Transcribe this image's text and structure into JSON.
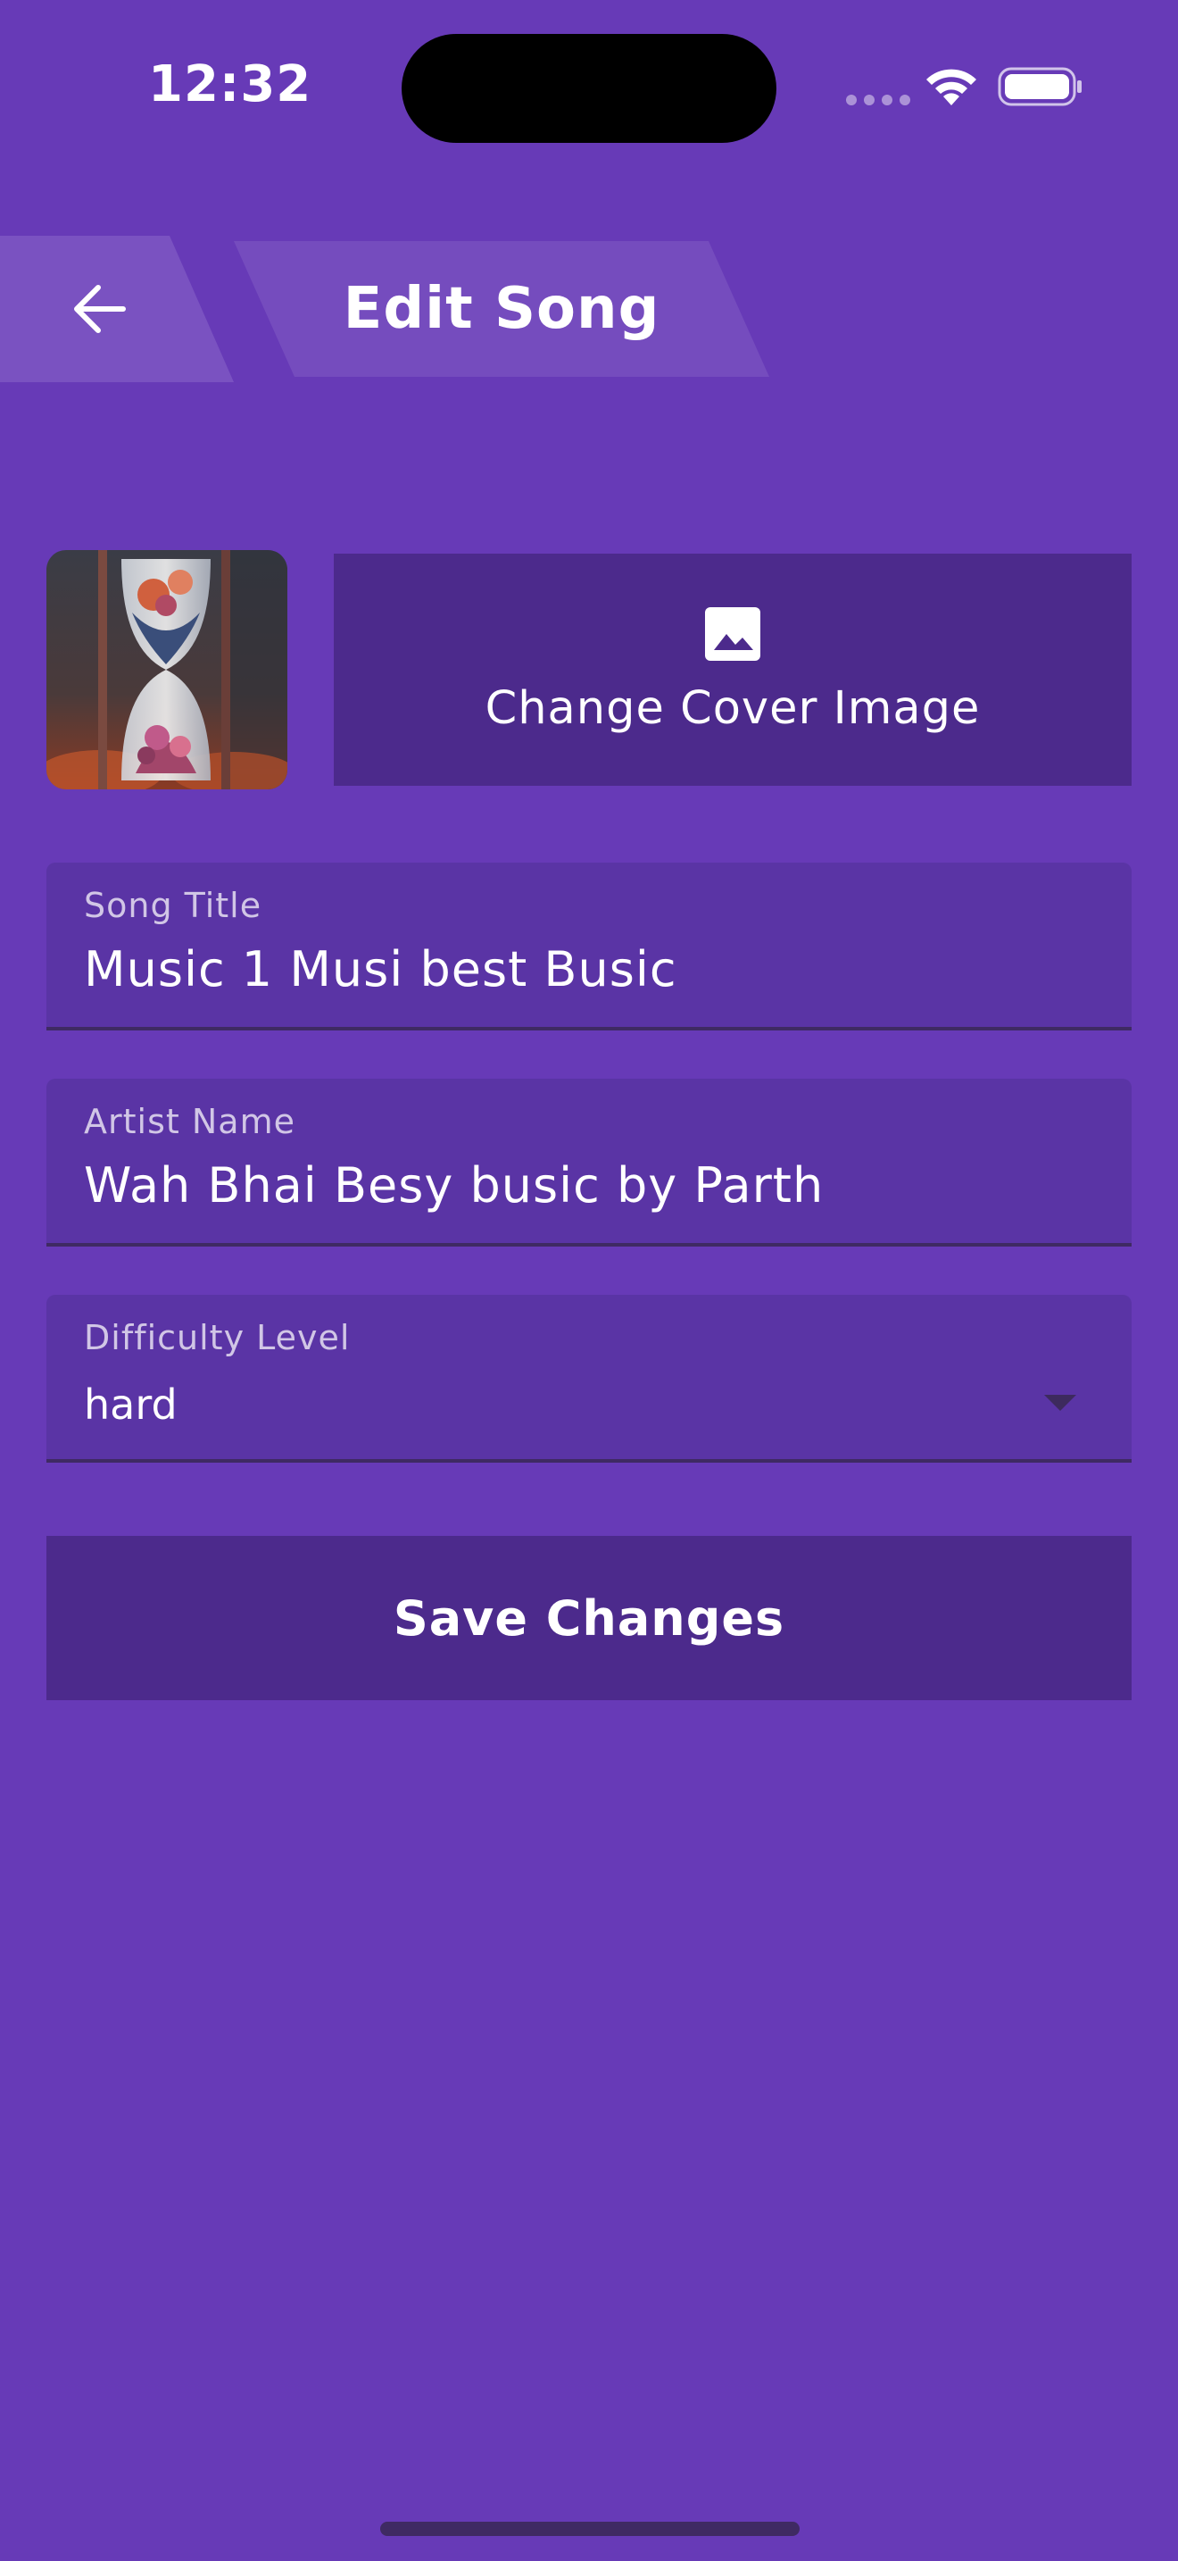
{
  "status_bar": {
    "time": "12:32",
    "icons": [
      "signal-icon",
      "wifi-icon",
      "battery-icon"
    ]
  },
  "header": {
    "back_icon": "arrow-left-icon",
    "title": "Edit Song"
  },
  "cover": {
    "thumbnail": "hourglass-cover-image",
    "change_label": "Change Cover Image",
    "change_icon": "image-icon"
  },
  "form": {
    "song_title": {
      "label": "Song Title",
      "value": "Music 1 Musi best Busic"
    },
    "artist_name": {
      "label": "Artist Name",
      "value": "Wah Bhai Besy busic by Parth"
    },
    "difficulty": {
      "label": "Difficulty Level",
      "value": "hard"
    }
  },
  "actions": {
    "save_label": "Save Changes"
  },
  "colors": {
    "background": "#673AB7",
    "button": "#4C2A8C",
    "field": "#5A34A5"
  }
}
